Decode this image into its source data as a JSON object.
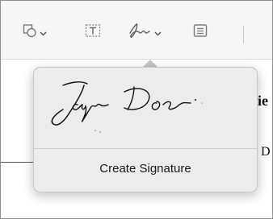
{
  "toolbar": {
    "items": [
      {
        "name": "shapes-icon",
        "has_chevron": true
      },
      {
        "name": "text-box-icon",
        "has_chevron": false
      },
      {
        "name": "signature-icon",
        "has_chevron": true
      },
      {
        "name": "note-icon",
        "has_chevron": false
      }
    ]
  },
  "document": {
    "snippet_1": "ie",
    "snippet_2": "D"
  },
  "signature_popover": {
    "saved_signature_text": "Jayne Doe",
    "create_label": "Create Signature"
  },
  "colors": {
    "toolbar_bg": "#f6f6f6",
    "popover_bg": "#ececec",
    "icon_gray": "#7a7a7a"
  }
}
